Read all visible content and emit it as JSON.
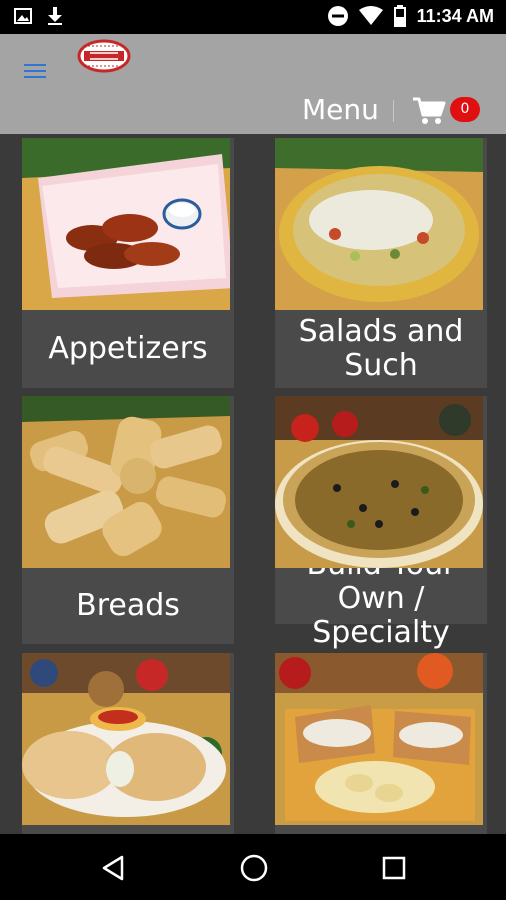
{
  "status_bar": {
    "time": "11:34 AM",
    "icons": [
      "image-icon",
      "download-icon",
      "dnd-icon",
      "wifi-icon",
      "battery-icon"
    ]
  },
  "header": {
    "menu_label": "Menu",
    "cart_count": "0",
    "icons": [
      "hamburger-icon",
      "logo",
      "cart-icon"
    ]
  },
  "categories": [
    {
      "label": "Appetizers",
      "image": "chicken-wings"
    },
    {
      "label": "Salads and Such",
      "image": "salad-bowl"
    },
    {
      "label": "Breads",
      "image": "garlic-breads"
    },
    {
      "label": "Build Your Own / Specialty",
      "image": "pizza"
    },
    {
      "label": "",
      "image": "calzone"
    },
    {
      "label": "",
      "image": "sandwich-chips"
    }
  ],
  "colors": {
    "background": "#3a3a3a",
    "appbar": "#a4a4a4",
    "badge": "#e01010",
    "hamburger": "#2f76d4"
  },
  "nav_bar": {
    "icons": [
      "back-icon",
      "home-icon",
      "recents-icon"
    ]
  }
}
